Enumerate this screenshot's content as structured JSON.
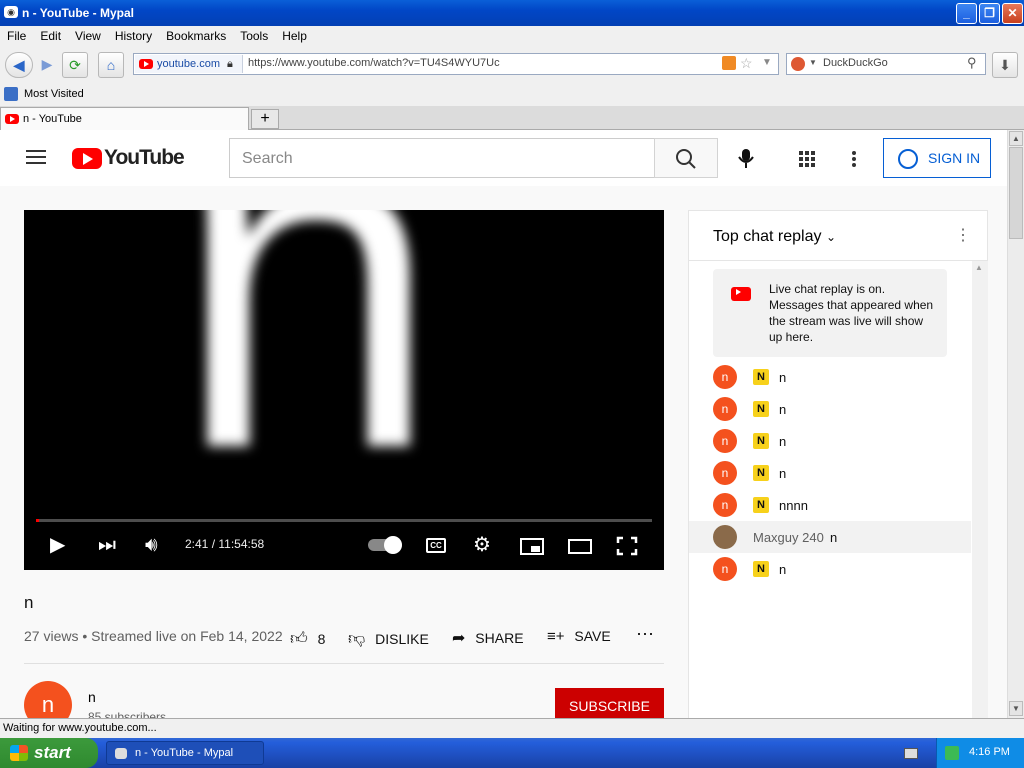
{
  "window": {
    "title": "n - YouTube - Mypal"
  },
  "menu": [
    "File",
    "Edit",
    "View",
    "History",
    "Bookmarks",
    "Tools",
    "Help"
  ],
  "nav": {
    "identity": "youtube.com",
    "url": "https://www.youtube.com/watch?v=TU4S4WYU7Uc",
    "search_engine": "DuckDuckGo"
  },
  "bookmarks": {
    "most_visited": "Most Visited"
  },
  "tabs": [
    {
      "label": "n - YouTube"
    }
  ],
  "youtube": {
    "logo_text": "YouTube",
    "search_placeholder": "Search",
    "sign_in": "SIGN IN",
    "video": {
      "letter": "n",
      "time": "2:41 / 11:54:58",
      "progress_fraction": 0.004,
      "title": "n",
      "meta": "27 views • Streamed live on Feb 14, 2022",
      "likes": "8",
      "dislike": "DISLIKE",
      "share": "SHARE",
      "save": "SAVE"
    },
    "channel": {
      "avatar_letter": "n",
      "name": "n",
      "subscribers": "85 subscribers",
      "subscribe": "SUBSCRIBE"
    },
    "chat": {
      "header": "Top chat replay",
      "banner": "Live chat replay is on. Messages that appeared when the stream was live will show up here.",
      "messages": [
        {
          "avatar": "n",
          "badge": "N",
          "text": "n"
        },
        {
          "avatar": "n",
          "badge": "N",
          "text": "n"
        },
        {
          "avatar": "n",
          "badge": "N",
          "text": "n"
        },
        {
          "avatar": "n",
          "badge": "N",
          "text": "n"
        },
        {
          "avatar": "n",
          "badge": "N",
          "text": "nnnn"
        },
        {
          "author": "Maxguy 240",
          "text": "n"
        },
        {
          "avatar": "n",
          "badge": "N",
          "text": "n"
        }
      ]
    }
  },
  "status": "Waiting for www.youtube.com...",
  "taskbar": {
    "start": "start",
    "item": "n - YouTube - Mypal",
    "clock": "4:16 PM"
  },
  "colors": {
    "accent": "#065fd4",
    "youtube_red": "#ff0000",
    "subscribe": "#cc0000",
    "avatar": "#f4511e",
    "badge": "#f7d11b"
  }
}
